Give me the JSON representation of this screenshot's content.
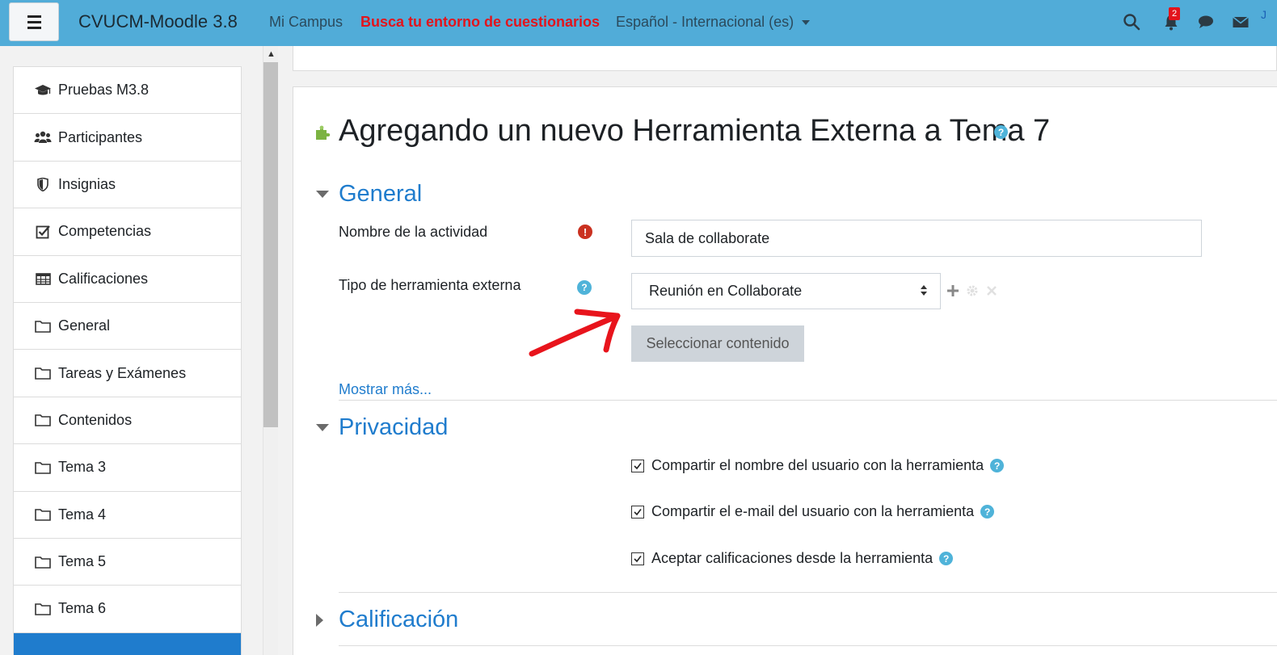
{
  "navbar": {
    "brand": "CVUCM-Moodle 3.8",
    "mi_campus": "Mi Campus",
    "busca": "Busca tu entorno de cuestionarios",
    "language": "Español - Internacional (es)",
    "notifications_count": "2",
    "user_initial": "J"
  },
  "drawer": {
    "items": [
      {
        "label": "Pruebas M3.8",
        "icon": "graduation-cap-icon"
      },
      {
        "label": "Participantes",
        "icon": "users-icon"
      },
      {
        "label": "Insignias",
        "icon": "shield-icon"
      },
      {
        "label": "Competencias",
        "icon": "check-square-icon"
      },
      {
        "label": "Calificaciones",
        "icon": "table-icon"
      },
      {
        "label": "General",
        "icon": "folder-icon"
      },
      {
        "label": "Tareas y Exámenes",
        "icon": "folder-icon"
      },
      {
        "label": "Contenidos",
        "icon": "folder-icon"
      },
      {
        "label": "Tema 3",
        "icon": "folder-icon"
      },
      {
        "label": "Tema 4",
        "icon": "folder-icon"
      },
      {
        "label": "Tema 5",
        "icon": "folder-icon"
      },
      {
        "label": "Tema 6",
        "icon": "folder-icon"
      }
    ]
  },
  "page": {
    "title": "Agregando un nuevo Herramienta Externa a Tema 7"
  },
  "general": {
    "heading": "General",
    "activity_name_label": "Nombre de la actividad",
    "activity_name_value": "Sala de collaborate",
    "tool_type_label": "Tipo de herramienta externa",
    "tool_type_value": "Reunión en Collaborate",
    "select_content_label": "Seleccionar contenido",
    "show_more": "Mostrar más..."
  },
  "privacy": {
    "heading": "Privacidad",
    "options": [
      {
        "label": "Compartir el nombre del usuario con la herramienta",
        "checked": true
      },
      {
        "label": "Compartir el e-mail del usuario con la herramienta",
        "checked": true
      },
      {
        "label": "Aceptar calificaciones desde la herramienta",
        "checked": true
      }
    ]
  },
  "grading": {
    "heading": "Calificación"
  },
  "colors": {
    "navbar": "#51acd8",
    "accent": "#1f7ccd",
    "busca_red": "#e3141c",
    "annotation_arrow": "#e8141c"
  }
}
